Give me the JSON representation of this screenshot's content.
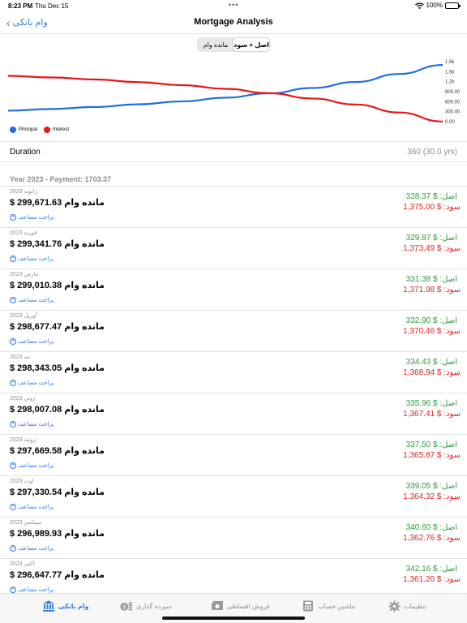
{
  "status_bar": {
    "time": "8:23 PM",
    "date": "Thu Dec 15",
    "battery": "100%"
  },
  "nav": {
    "back_label": "وام بانکی",
    "title": "Mortgage Analysis"
  },
  "segment": {
    "options": [
      "مانده وام",
      "اصل + سود"
    ],
    "selected": "اصل + سود"
  },
  "chart_data": {
    "type": "line",
    "title": "",
    "xlabel": "",
    "ylabel": "",
    "y_ticks": [
      "1.8k",
      "1.5k",
      "1.2k",
      "900.00",
      "600.00",
      "300.00",
      "0.00"
    ],
    "ylim": [
      0,
      1800
    ],
    "x": [
      0,
      36,
      72,
      108,
      144,
      180,
      216,
      252,
      288,
      324,
      360
    ],
    "series": [
      {
        "name": "Principal",
        "color": "#1f6fe0",
        "values": [
          330,
          380,
          440,
          520,
          610,
          720,
          850,
          1010,
          1190,
          1430,
          1700
        ]
      },
      {
        "name": "Interest",
        "color": "#e41818",
        "values": [
          1375,
          1325,
          1265,
          1185,
          1095,
          985,
          855,
          695,
          515,
          275,
          5
        ]
      }
    ],
    "legend_position": "bottom-left",
    "grid": false
  },
  "duration": {
    "label": "Duration",
    "value": "360 (30.0 yrs)"
  },
  "year_header": "Year 2023 - Payment: 1703.37",
  "prepay_label": "پراخت مضاعف",
  "rows": [
    {
      "month": "ژانویه 2023",
      "balance": "$ 299,671.63 مانده وام",
      "principal": "اصل: $ 328.37",
      "interest": "سود: $ 1,375.00"
    },
    {
      "month": "فوریه 2023",
      "balance": "$ 299,341.76 مانده وام",
      "principal": "اصل: $ 329.87",
      "interest": "سود: $ 1,373.49"
    },
    {
      "month": "مارس 2023",
      "balance": "$ 299,010.38 مانده وام",
      "principal": "اصل: $ 331.38",
      "interest": "سود: $ 1,371.98"
    },
    {
      "month": "آوریل 2023",
      "balance": "$ 298,677.47 مانده وام",
      "principal": "اصل: $ 332.90",
      "interest": "سود: $ 1,370.46"
    },
    {
      "month": "مه 2023",
      "balance": "$ 298,343.05 مانده وام",
      "principal": "اصل: $ 334.43",
      "interest": "سود: $ 1,368.94"
    },
    {
      "month": "ژوئن 2023",
      "balance": "$ 298,007.08 مانده وام",
      "principal": "اصل: $ 335.96",
      "interest": "سود: $ 1,367.41"
    },
    {
      "month": "ژوئیه 2023",
      "balance": "$ 297,669.58 مانده وام",
      "principal": "اصل: $ 337.50",
      "interest": "سود: $ 1,365.87"
    },
    {
      "month": "اوت 2023",
      "balance": "$ 297,330.54 مانده وام",
      "principal": "اصل: $ 339.05",
      "interest": "سود: $ 1,364.32"
    },
    {
      "month": "سپتامبر 2023",
      "balance": "$ 296,989.93 مانده وام",
      "principal": "اصل: $ 340.60",
      "interest": "سود: $ 1,362.76"
    },
    {
      "month": "اکتبر 2023",
      "balance": "$ 296,647.77 مانده وام",
      "principal": "اصل: $ 342.16",
      "interest": "سود: $ 1,361.20"
    }
  ],
  "tabbar": {
    "tabs": [
      {
        "label": "وام بانکی",
        "icon": "bank-icon",
        "active": true
      },
      {
        "label": "سپرده گذاری",
        "icon": "coins-icon",
        "active": false
      },
      {
        "label": "فروش اقساطی",
        "icon": "cash-icon",
        "active": false
      },
      {
        "label": "ماشین حساب",
        "icon": "calculator-icon",
        "active": false
      },
      {
        "label": "تنظیمات",
        "icon": "gear-icon",
        "active": false
      }
    ]
  }
}
